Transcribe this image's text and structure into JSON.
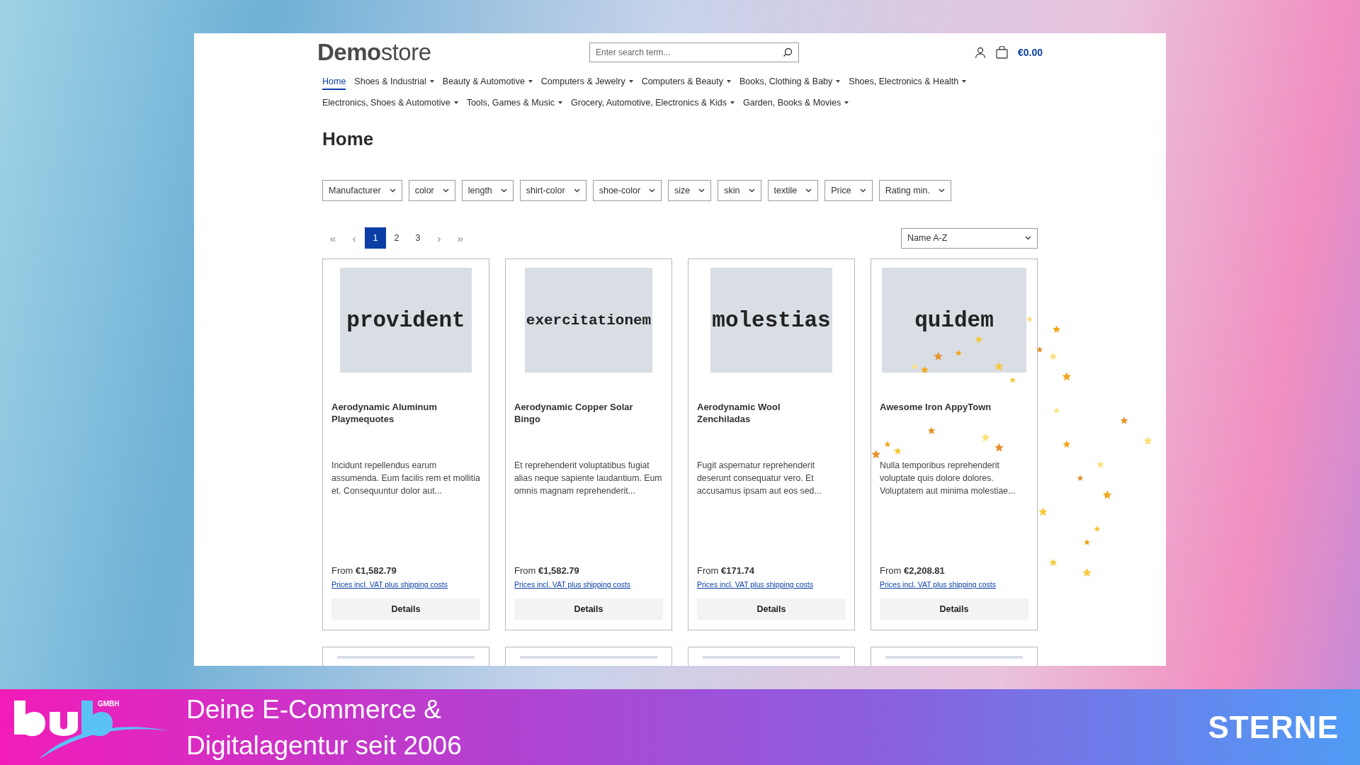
{
  "header": {
    "logo": "**Demo**store",
    "search": {
      "placeholder": "Enter search term..."
    },
    "cart_total": "€0.00"
  },
  "nav": [
    [
      {
        "label": "Home",
        "selected": true,
        "dropdown": false
      },
      {
        "label": "Shoes & Industrial",
        "selected": false,
        "dropdown": true
      },
      {
        "label": "Beauty & Automotive",
        "selected": false,
        "dropdown": true
      },
      {
        "label": "Computers & Jewelry",
        "selected": false,
        "dropdown": true
      },
      {
        "label": "Computers & Beauty",
        "selected": false,
        "dropdown": true
      },
      {
        "label": "Books, Clothing & Baby",
        "selected": false,
        "dropdown": true
      },
      {
        "label": "Shoes, Electronics & Health",
        "selected": false,
        "dropdown": true
      }
    ],
    [
      {
        "label": "Electronics, Shoes & Automotive",
        "selected": false,
        "dropdown": true
      },
      {
        "label": "Tools, Games & Music",
        "selected": false,
        "dropdown": true
      },
      {
        "label": "Grocery, Automotive, Electronics & Kids",
        "selected": false,
        "dropdown": true
      },
      {
        "label": "Garden, Books & Movies",
        "selected": false,
        "dropdown": true
      }
    ]
  ],
  "page_title": "Home",
  "filters": [
    "Manufacturer",
    "color",
    "length",
    "shirt-color",
    "shoe-color",
    "size",
    "skin",
    "textile",
    "Price",
    "Rating min."
  ],
  "pagination": [
    {
      "label": "«",
      "kind": "arrow",
      "selected": false
    },
    {
      "label": "‹",
      "kind": "arrow",
      "selected": false
    },
    {
      "label": "1",
      "kind": "page",
      "selected": true
    },
    {
      "label": "2",
      "kind": "page",
      "selected": false
    },
    {
      "label": "3",
      "kind": "page",
      "selected": false
    },
    {
      "label": "›",
      "kind": "arrow",
      "selected": false
    },
    {
      "label": "»",
      "kind": "arrow",
      "selected": false
    }
  ],
  "sort": {
    "value": "Name A-Z"
  },
  "products": [
    {
      "kind": "full",
      "image_text": "provident",
      "name": "Aerodynamic Aluminum Playmequotes",
      "description": "Incidunt repellendus earum assumenda. Eum facilis rem et mollitia et. Consequuntur dolor aut...",
      "price_prefix": "From",
      "price": "€1,582.79",
      "vat_link": "Prices incl. VAT plus shipping costs",
      "button": "Details"
    },
    {
      "kind": "full",
      "image_text": "exercitationem",
      "name": "Aerodynamic Copper Solar Bingo",
      "description": "Et reprehenderit voluptatibus fugiat alias neque sapiente laudantium. Eum omnis magnam reprehenderit...",
      "price_prefix": "From",
      "price": "€1,582.79",
      "vat_link": "Prices incl. VAT plus shipping costs",
      "button": "Details"
    },
    {
      "kind": "full",
      "image_text": "molestias",
      "name": "Aerodynamic Wool Zenchiladas",
      "description": "Fugit aspernatur reprehenderit deserunt consequatur vero. Et accusamus ipsam aut eos sed...",
      "price_prefix": "From",
      "price": "€171.74",
      "vat_link": "Prices incl. VAT plus shipping costs",
      "button": "Details"
    },
    {
      "kind": "full",
      "image_text": "quidem",
      "name": "Awesome Iron AppyTown",
      "description": "Nulla temporibus reprehenderit voluptate quis dolore dolores. Voluptatem aut minima molestiae...",
      "price_prefix": "From",
      "price": "€2,208.81",
      "vat_link": "Prices incl. VAT plus shipping costs",
      "button": "Details"
    },
    {
      "kind": "partial"
    },
    {
      "kind": "partial"
    },
    {
      "kind": "partial"
    },
    {
      "kind": "partial"
    }
  ],
  "banner": {
    "brand_suffix": "GMBH",
    "tagline": "Deine E-Commerce & Digitalagentur seit 2006",
    "label": "STERNE"
  }
}
